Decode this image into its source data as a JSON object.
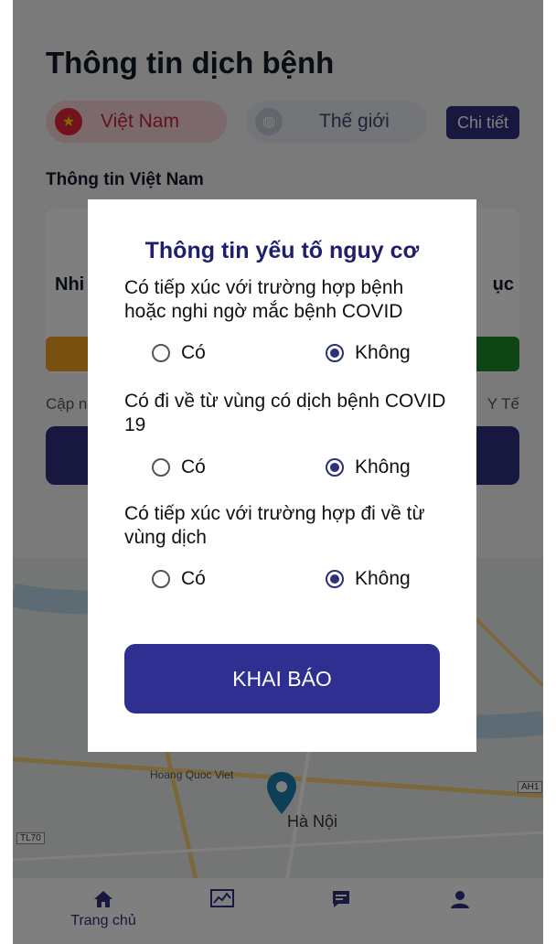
{
  "background": {
    "page_title": "Thông tin dịch bệnh",
    "tabs": [
      {
        "label": "Việt Nam",
        "icon": "star-icon"
      },
      {
        "label": "Thế giới",
        "icon": "globe-icon"
      }
    ],
    "detail_button": "Chi tiết",
    "section_title": "Thông tin Việt Nam",
    "stat_label_left": "Nhi",
    "stat_label_right": "ục",
    "update_left": "Cập n",
    "update_right": "Y Tế",
    "map": {
      "city_label": "Hà Nội",
      "area_label": "Hoang Quoc Viet",
      "road_badges": [
        "AH1",
        "TL70"
      ]
    },
    "bottom_nav": [
      {
        "label": "Trang chủ",
        "icon": "home-icon"
      },
      {
        "label": "",
        "icon": "chart-icon"
      },
      {
        "label": "",
        "icon": "message-icon"
      },
      {
        "label": "",
        "icon": "user-icon"
      }
    ]
  },
  "modal": {
    "title": "Thông tin yếu tố nguy cơ",
    "questions": [
      {
        "text": "Có tiếp xúc với trường hợp bệnh hoặc nghi ngờ mắc bệnh COVID",
        "yes": "Có",
        "no": "Không",
        "selected": "no"
      },
      {
        "text": "Có đi về từ vùng có dịch bệnh COVID 19",
        "yes": "Có",
        "no": "Không",
        "selected": "no"
      },
      {
        "text": "Có tiếp xúc với trường hợp đi về từ vùng dịch",
        "yes": "Có",
        "no": "Không",
        "selected": "no"
      }
    ],
    "submit_label": "KHAI BÁO"
  },
  "colors": {
    "primary": "#2e2f7f",
    "accent_red": "#e0263a",
    "overlay": "rgba(0,0,0,0.5)"
  }
}
